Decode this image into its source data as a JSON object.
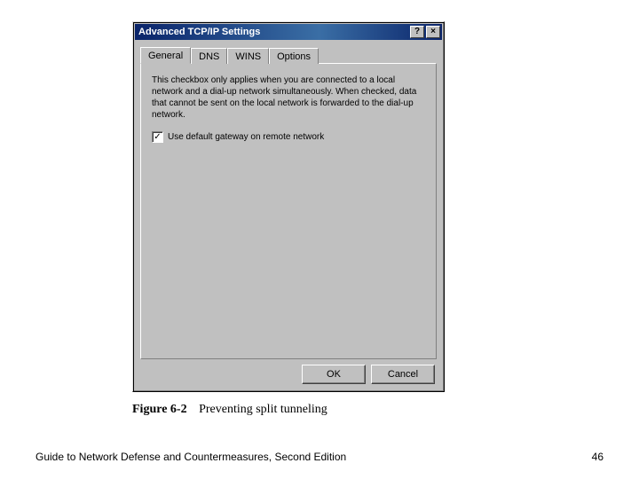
{
  "dialog": {
    "title": "Advanced TCP/IP Settings",
    "help_icon": "?",
    "close_icon": "×",
    "tabs": {
      "general": "General",
      "dns": "DNS",
      "wins": "WINS",
      "options": "Options"
    },
    "description": "This checkbox only applies when you are connected to a local network and a dial-up network simultaneously. When checked, data that cannot be sent on the local network is forwarded to the dial-up network.",
    "checkbox": {
      "checked_mark": "✓",
      "label": "Use default gateway on remote network"
    },
    "buttons": {
      "ok": "OK",
      "cancel": "Cancel"
    }
  },
  "figure": {
    "number": "Figure 6-2",
    "caption": "Preventing split tunneling"
  },
  "footer": {
    "book": "Guide to Network Defense and Countermeasures, Second Edition",
    "page": "46"
  }
}
